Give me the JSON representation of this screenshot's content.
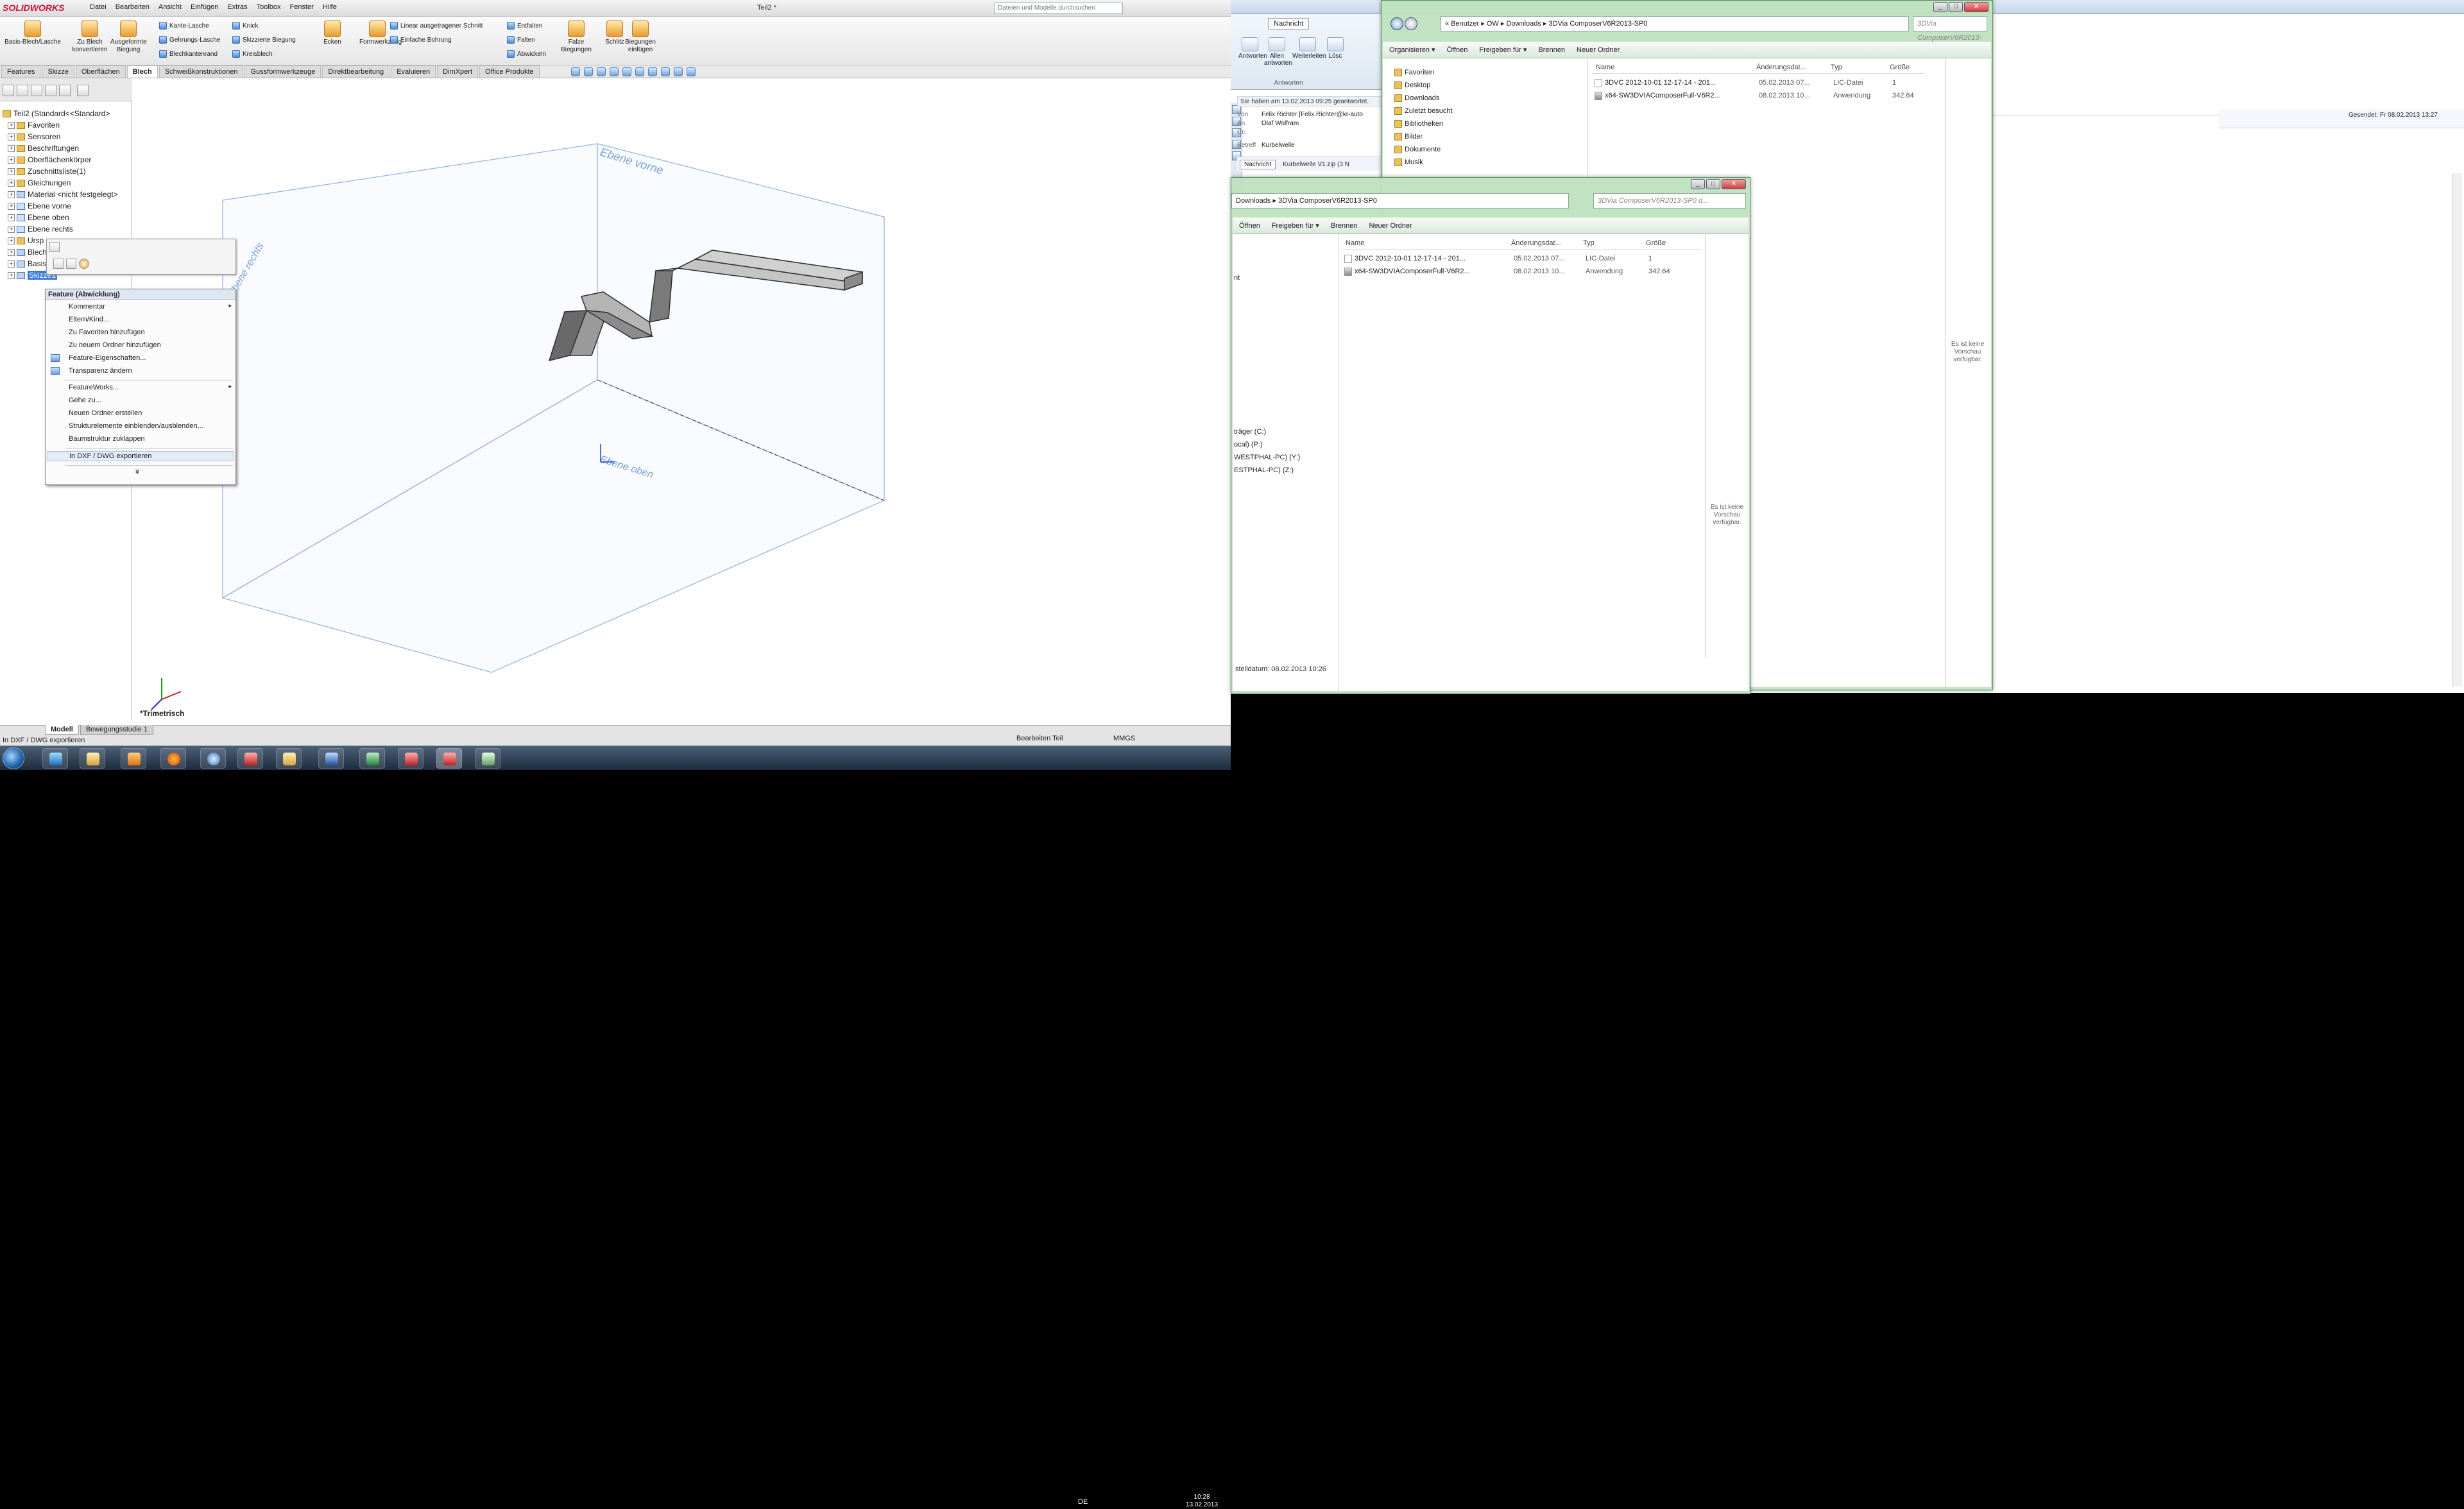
{
  "solidworks": {
    "logo": "SOLIDWORKS",
    "menu": [
      "Datei",
      "Bearbeiten",
      "Ansicht",
      "Einfügen",
      "Extras",
      "Toolbox",
      "Fenster",
      "Hilfe"
    ],
    "doc_title": "Teil2 *",
    "search_placeholder": "Dateien und Modelle durchsuchen",
    "ribbon_big": [
      {
        "label": "Basis-Blech/Lasche",
        "icon": "base-flange-icon"
      },
      {
        "label": "Zu Blech konvertieren",
        "icon": "convert-sheetmetal-icon"
      },
      {
        "label": "Ausgeformte Biegung",
        "icon": "lofted-bend-icon"
      },
      {
        "label": "Ecken",
        "icon": "corners-icon"
      },
      {
        "label": "Formwerkzeug",
        "icon": "forming-tool-icon"
      },
      {
        "label": "Falze Biegungen",
        "icon": "unbend-icon"
      },
      {
        "label": "Schlitz",
        "icon": "slot-icon"
      },
      {
        "label": "Biegungen einfügen",
        "icon": "insert-bends-icon"
      }
    ],
    "ribbon_small_col1": [
      "Kante-Lasche",
      "Gehrungs-Lasche",
      "Blechkantenrand"
    ],
    "ribbon_small_col2": [
      "Knick",
      "Skizzierte Biegung",
      "Kreisblech"
    ],
    "ribbon_small_col3": [
      "Linear ausgetragener Schnitt",
      "Einfache Bohrung"
    ],
    "ribbon_small_col4": [
      "Entfalten",
      "Falten",
      "Abwickeln"
    ],
    "tabs": [
      "Features",
      "Skizze",
      "Oberflächen",
      "Blech",
      "Schweißkonstruktionen",
      "Gussformwerkzeuge",
      "Direktbearbeitung",
      "Evaluieren",
      "DimXpert",
      "Office Produkte"
    ],
    "active_tab": "Blech",
    "tree": [
      {
        "label": "Teil2  (Standard<<Standard>",
        "type": "root"
      },
      {
        "label": "Favoriten",
        "type": "folder"
      },
      {
        "label": "Sensoren",
        "type": "folder"
      },
      {
        "label": "Beschriftungen",
        "type": "folder"
      },
      {
        "label": "Oberflächenkörper",
        "type": "folder"
      },
      {
        "label": "Zuschnittsliste(1)",
        "type": "folder"
      },
      {
        "label": "Gleichungen",
        "type": "folder"
      },
      {
        "label": "Material <nicht festgelegt>",
        "type": "feature"
      },
      {
        "label": "Ebene vorne",
        "type": "plane"
      },
      {
        "label": "Ebene oben",
        "type": "plane"
      },
      {
        "label": "Ebene rechts",
        "type": "plane"
      },
      {
        "label": "Ursp",
        "type": "origin"
      },
      {
        "label": "Blech",
        "type": "feature"
      },
      {
        "label": "Basis",
        "type": "feature"
      },
      {
        "label": "Skizze1",
        "type": "selected"
      }
    ],
    "context_menu": {
      "header": "Feature (Abwicklung)",
      "items": [
        {
          "label": "Kommentar",
          "arrow": true
        },
        {
          "label": "Eltern/Kind...",
          "arrow": false
        },
        {
          "label": "Zu Favoriten hinzufügen",
          "arrow": false
        },
        {
          "label": "Zu neuem Ordner hinzufügen",
          "arrow": false
        },
        {
          "label": "Feature-Eigenschaften...",
          "arrow": false,
          "icon": true
        },
        {
          "label": "Transparenz ändern",
          "arrow": false,
          "icon": true
        },
        {
          "label": "FeatureWorks...",
          "arrow": true
        },
        {
          "label": "Gehe zu...",
          "arrow": false
        },
        {
          "label": "Neuen Ordner erstellen",
          "arrow": false
        },
        {
          "label": "Strukturelemente einblenden/ausblenden...",
          "arrow": false
        },
        {
          "label": "Baumstruktur zuklappen",
          "arrow": false
        },
        {
          "label": "In DXF / DWG exportieren",
          "arrow": false,
          "highlight": true
        },
        {
          "label": "¥",
          "arrow": false
        }
      ]
    },
    "plane_labels": {
      "front": "Ebene vorne",
      "right": "Ebene rechts",
      "top": "Ebene oben"
    },
    "view_label": "*Trimetrisch",
    "bottom_tabs": [
      "Modell",
      "Bewegungsstudie 1"
    ],
    "status_left": "In DXF / DWG exportieren",
    "status_mid": "Bearbeiten Teil",
    "status_units": "MMGS"
  },
  "outlook": {
    "tab": "Nachricht",
    "buttons": [
      "Antworten",
      "Allen antworten",
      "Weiterleiten",
      "Lösc"
    ],
    "group": "Antworten",
    "info": "Sie haben am 13.02.2013 09:25 geantwortet.",
    "from": "Felix Richter [Felix.Richter@kr-auto",
    "to": "Olaf Wolfram",
    "cc": "",
    "subject": "Kurbelwelle",
    "from_label": "Von",
    "to_label": "An",
    "cc_label": "Cc",
    "subject_label": "Betreff",
    "attachment_tab": "Nachricht",
    "attachment": "Kurbelwelle V1.zip (3 N",
    "sent": "Gesendet:   Fr 08.02.2013 13:27"
  },
  "explorer_back": {
    "path": [
      "Benutzer",
      "OW",
      "Downloads",
      "3DVia ComposerV6R2013-SP0"
    ],
    "search": "3DVia ComposerV6R2013-SP0 d...",
    "toolbar": [
      "Organisieren ▾",
      "Öffnen",
      "Freigeben für ▾",
      "Brennen",
      "Neuer Ordner"
    ],
    "nav": [
      "Favoriten",
      "Desktop",
      "Downloads",
      "Zuletzt besucht",
      "Bibliotheken",
      "Bilder",
      "Dokumente",
      "Musik"
    ],
    "headers": [
      "Name",
      "Änderungsdat...",
      "Typ",
      "Größe"
    ],
    "rows": [
      {
        "name": "3DVC 2012-10-01 12-17-14 - 201...",
        "date": "05.02.2013 07...",
        "type": "LIC-Datei",
        "size": "1"
      },
      {
        "name": "x64-SW3DVIAComposerFull-V6R2...",
        "date": "08.02.2013 10...",
        "type": "Anwendung",
        "size": "342.64"
      }
    ],
    "preview": "Es ist keine Vorschau verfügbar."
  },
  "explorer_front": {
    "path": [
      "Downloads",
      "3DVia ComposerV6R2013-SP0"
    ],
    "search": "3DVia ComposerV6R2013-SP0 d...",
    "toolbar": [
      "Öffnen",
      "Freigeben für ▾",
      "Brennen",
      "Neuer Ordner"
    ],
    "nav": [
      "nt",
      "träger (C:)",
      "ocal) (P:)",
      "WESTPHAL-PC) (Y:)",
      "ESTPHAL-PC) (Z:)"
    ],
    "headers": [
      "Name",
      "Änderungsdat...",
      "Typ",
      "Größe"
    ],
    "rows": [
      {
        "name": "3DVC 2012-10-01 12-17-14 - 201...",
        "date": "05.02.2013 07...",
        "type": "LIC-Datei",
        "size": "1"
      },
      {
        "name": "x64-SW3DVIAComposerFull-V6R2...",
        "date": "08.02.2013 10...",
        "type": "Anwendung",
        "size": "342.64"
      }
    ],
    "preview": "Es ist keine Vorschau verfügbar.",
    "details": "stelldatum: 08.02.2013 10:26"
  },
  "taskbar": {
    "lang": "DE",
    "time": "10:28",
    "date": "13.02.2013"
  }
}
